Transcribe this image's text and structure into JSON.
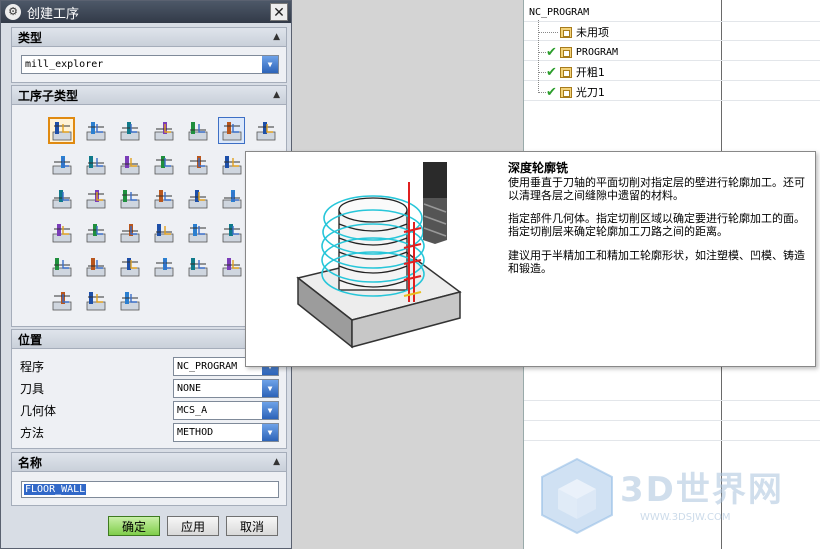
{
  "dialog": {
    "title": "创建工序",
    "type_section": {
      "label": "类型",
      "selected": "mill_explorer"
    },
    "subtype_section": {
      "label": "工序子类型"
    },
    "location_section": {
      "label": "位置",
      "fields": [
        {
          "label": "程序",
          "value": "NC_PROGRAM"
        },
        {
          "label": "刀具",
          "value": "NONE"
        },
        {
          "label": "几何体",
          "value": "MCS_A"
        },
        {
          "label": "方法",
          "value": "METHOD"
        }
      ]
    },
    "name_section": {
      "label": "名称",
      "value": "FLOOR_WALL"
    },
    "buttons": {
      "ok": "确定",
      "apply": "应用",
      "cancel": "取消"
    }
  },
  "navigator": {
    "root": "NC_PROGRAM",
    "items": [
      {
        "label": "未用项",
        "checked": false
      },
      {
        "label": "PROGRAM",
        "checked": true
      },
      {
        "label": "开粗1",
        "checked": true
      },
      {
        "label": "光刀1",
        "checked": true
      }
    ]
  },
  "tooltip": {
    "title": "深度轮廓铣",
    "paragraphs": [
      "使用垂直于刀轴的平面切削对指定层的壁进行轮廓加工。还可以清理各层之间缝隙中遗留的材料。",
      "指定部件几何体。指定切削区域以确定要进行轮廓加工的面。指定切削层来确定轮廓加工刀路之间的距离。",
      "建议用于半精加工和精加工轮廓形状，如注塑模、凹模、铸造和锻造。"
    ]
  },
  "watermark": {
    "text": "3D世界网",
    "url": "WWW.3DSJW.COM"
  }
}
